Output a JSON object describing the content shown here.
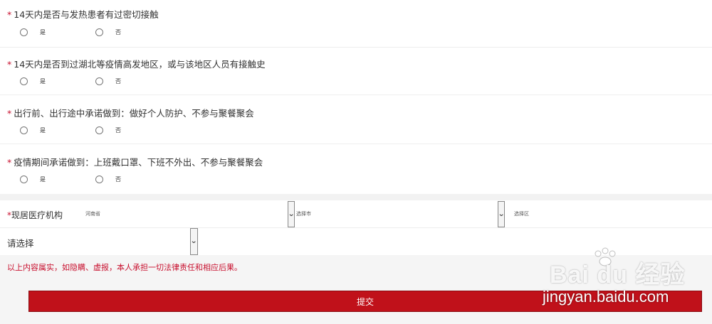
{
  "questions": [
    {
      "title": "14天内是否与发热患者有过密切接触",
      "options": [
        "是",
        "否"
      ]
    },
    {
      "title": "14天内是否到过湖北等疫情高发地区，或与该地区人员有接触史",
      "options": [
        "是",
        "否"
      ]
    },
    {
      "title": "出行前、出行途中承诺做到：做好个人防护、不参与聚餐聚会",
      "options": [
        "是",
        "否"
      ]
    },
    {
      "title": "疫情期间承诺做到：上班戴口罩、下班不外出、不参与聚餐聚会",
      "options": [
        "是",
        "否"
      ]
    }
  ],
  "required_mark": "*",
  "institution": {
    "label": "现居医疗机构",
    "province": "河南省",
    "city": "选择市",
    "district": "选择区",
    "hospital": "请选择"
  },
  "disclaimer": "以上内容属实，如隐瞒、虚报，本人承担一切法律责任和相应后果。",
  "submit_label": "提交",
  "watermark": {
    "brand": "Bai du 经验",
    "url": "jingyan.baidu.com"
  },
  "colors": {
    "accent": "#c0111a",
    "required": "#c8102e"
  }
}
